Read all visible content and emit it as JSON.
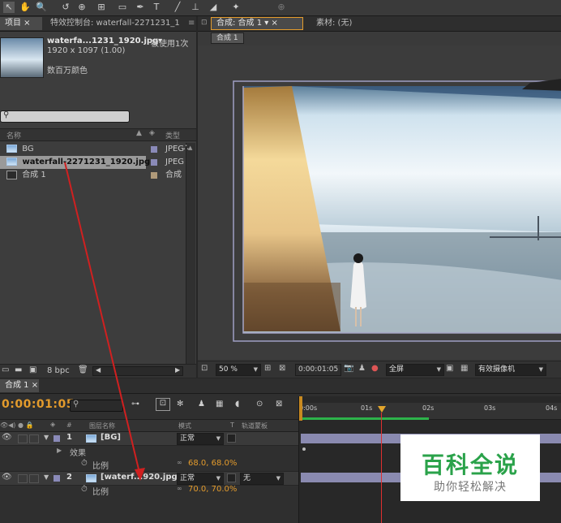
{
  "project_panel": {
    "tab_label": "项目",
    "effects_tab_label": "特效控制台: waterfall-2271231_1",
    "preview": {
      "name": "waterfa...1231_1920.jpg▾",
      "usage": "被使用1次",
      "dims": "1920 x 1097 (1.00)",
      "colors": "数百万颜色"
    },
    "search_placeholder": "",
    "columns": {
      "name": "名称",
      "type": "类型"
    },
    "items": [
      {
        "name": "BG",
        "type": "",
        "color": "#8a8ab8"
      },
      {
        "name": "waterfall-2271231_1920.jpg",
        "type": "JPEG",
        "color": "#8a8ab8"
      },
      {
        "name": "合成 1",
        "type": "合成",
        "color": "#b09a7a"
      }
    ],
    "first_row_type": "JPEG",
    "bpc": "8 bpc"
  },
  "comp_viewer": {
    "tab_label": "合成: 合成 1",
    "footage_tab": "素材: (无)",
    "breadcrumb": "合成 1",
    "zoom": "50 %",
    "timecode": "0:00:01:05",
    "resolution": "全屏",
    "camera": "有效摄像机"
  },
  "timeline": {
    "tab_label": "合成 1",
    "timecode": "0:00:01:05",
    "search_placeholder": "",
    "headers": {
      "num": "#",
      "source": "图层名称",
      "mode": "模式",
      "t": "T",
      "trkmat": "轨道蒙板"
    },
    "layers": [
      {
        "num": "1",
        "name": "[BG]",
        "mode": "正常",
        "color": "#8a8ab8"
      },
      {
        "num": "2",
        "name": "[waterf...920.jpg]",
        "mode": "正常",
        "trkmat": "无",
        "color": "#8a8ab8"
      }
    ],
    "effects_label": "效果",
    "scale_label": "比例",
    "scale_1": "68.0, 68.0%",
    "scale_2": "70.0, 70.0%",
    "ruler": [
      "0:00s",
      "01s",
      "02s",
      "03s",
      "04s"
    ],
    "colors": {
      "bar": "#8a8ab0",
      "playhead": "#e03030",
      "work_area": "#2db34a"
    }
  },
  "watermark": {
    "title": "百科全说",
    "subtitle": "助你轻松解决",
    "color": "#2aa24a"
  },
  "colors": {
    "annotation_arrow": "#d02020"
  }
}
